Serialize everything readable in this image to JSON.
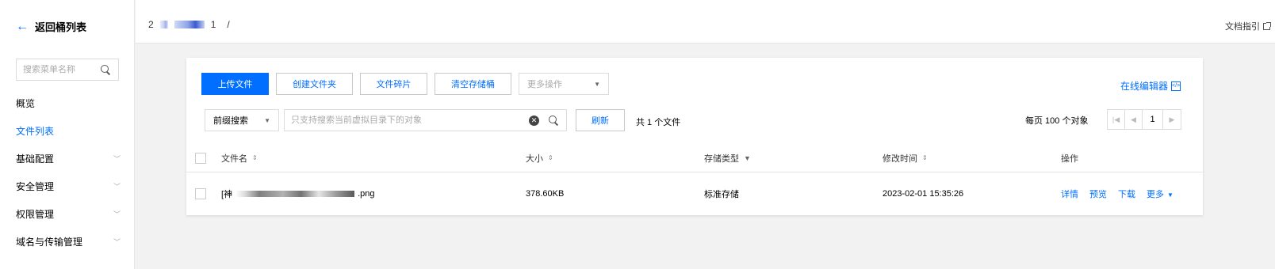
{
  "sidebar": {
    "back_label": "返回桶列表",
    "search_placeholder": "搜索菜单名称",
    "items": [
      {
        "label": "概览",
        "active": false,
        "expandable": false
      },
      {
        "label": "文件列表",
        "active": true,
        "expandable": false
      },
      {
        "label": "基础配置",
        "active": false,
        "expandable": true
      },
      {
        "label": "安全管理",
        "active": false,
        "expandable": true
      },
      {
        "label": "权限管理",
        "active": false,
        "expandable": true
      },
      {
        "label": "域名与传输管理",
        "active": false,
        "expandable": true
      }
    ]
  },
  "topbar": {
    "bucket_prefix": "2",
    "bucket_suffix": "1",
    "separator": "/",
    "docs_label": "文档指引"
  },
  "toolbar": {
    "upload_label": "上传文件",
    "create_folder_label": "创建文件夹",
    "fragments_label": "文件碎片",
    "clear_bucket_label": "清空存储桶",
    "more_actions_label": "更多操作",
    "online_editor_label": "在线编辑器"
  },
  "search": {
    "mode_label": "前缀搜索",
    "placeholder": "只支持搜索当前虚拟目录下的对象",
    "refresh_label": "刷新",
    "total_label": "共 1 个文件"
  },
  "pagination": {
    "per_page_label": "每页 100 个对象",
    "current_page": "1"
  },
  "table": {
    "headers": {
      "name": "文件名",
      "size": "大小",
      "storage": "存储类型",
      "modified": "修改时间",
      "actions": "操作"
    },
    "rows": [
      {
        "name_prefix": "[神",
        "name_suffix": ".png",
        "size": "378.60KB",
        "storage": "标准存储",
        "modified": "2023-02-01 15:35:26",
        "actions": [
          "详情",
          "预览",
          "下载",
          "更多"
        ]
      }
    ]
  },
  "colors": {
    "accent": "#006eff",
    "background": "#f2f2f2"
  }
}
